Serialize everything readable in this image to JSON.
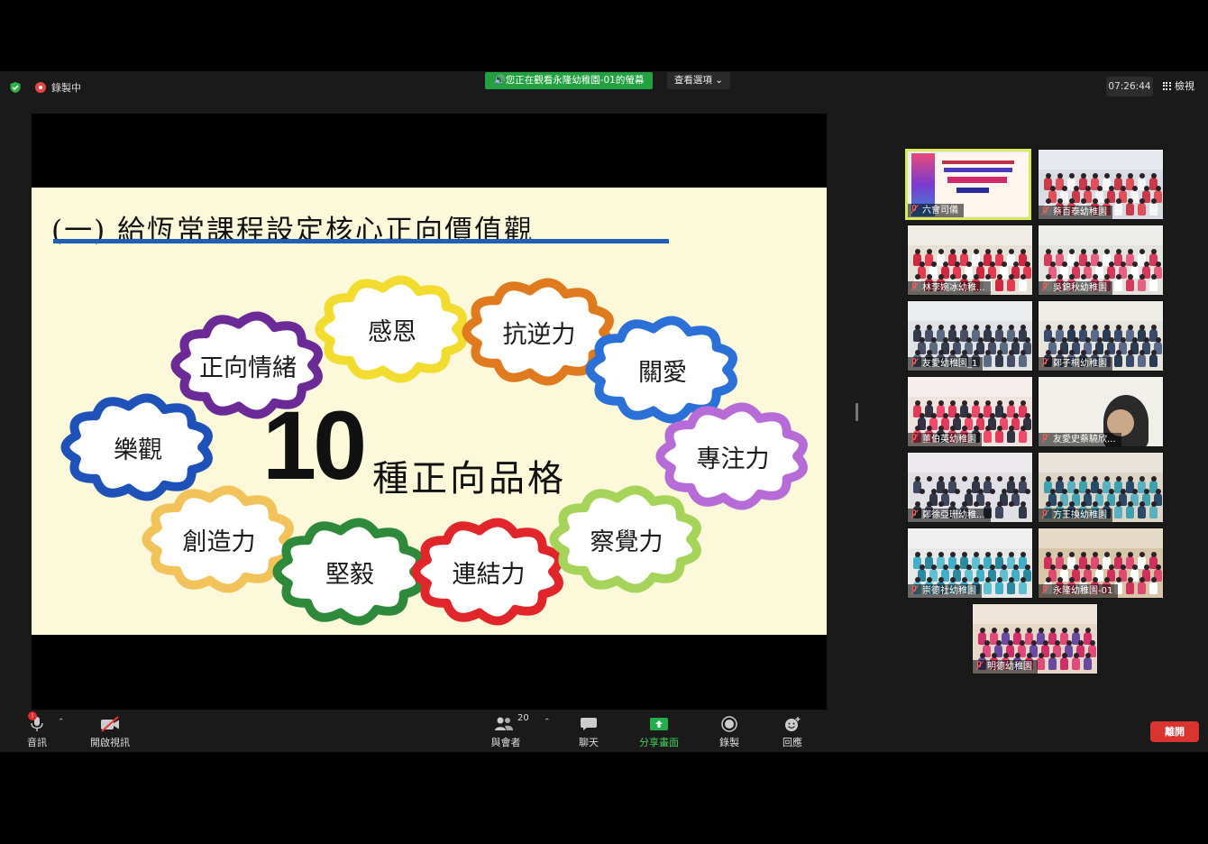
{
  "topbar": {
    "recording_label": "錄製中",
    "viewing_banner": "您正在觀看永隆幼稚園-01的螢幕",
    "view_options": "查看選項",
    "timer": "07:26:44",
    "gallery_view": "檢視"
  },
  "slide": {
    "title": "(一) 給恆常課程設定核心正向價值觀",
    "big_number": "10",
    "big_text": "種正向品格",
    "traits": [
      "正向情緒",
      "感恩",
      "抗逆力",
      "關愛",
      "樂觀",
      "專注力",
      "創造力",
      "堅毅",
      "連結力",
      "察覺力"
    ],
    "trait_colors": [
      "#6b2a96",
      "#f2dc2f",
      "#e07a1f",
      "#2a70d6",
      "#1f52b8",
      "#b66bd6",
      "#f1c35a",
      "#2e8a3a",
      "#e0262a",
      "#a6d35a"
    ]
  },
  "participants": [
    {
      "name": "六會司儀",
      "muted": true
    },
    {
      "name": "蔡百泰幼稚園",
      "muted": true
    },
    {
      "name": "林李婉冰幼稚...",
      "muted": true
    },
    {
      "name": "吳錦秋幼稚園",
      "muted": true
    },
    {
      "name": "友愛幼稚園_1",
      "muted": true
    },
    {
      "name": "鄭子桐幼稚園",
      "muted": true
    },
    {
      "name": "董伯英幼稚園",
      "muted": true
    },
    {
      "name": "友愛史蔡驍欣...",
      "muted": true
    },
    {
      "name": "鄭徐亞珊幼稚...",
      "muted": true
    },
    {
      "name": "方王換幼稚園",
      "muted": true
    },
    {
      "name": "崇德社幼稚園",
      "muted": true
    },
    {
      "name": "永隆幼稚園-01",
      "muted": true
    },
    {
      "name": "明德幼稚園",
      "muted": true
    }
  ],
  "toolbar": {
    "audio": "音訊",
    "audio_badge": "!",
    "video": "開啟視訊",
    "participants": "與會者",
    "participants_count": "20",
    "chat": "聊天",
    "share": "分享畫面",
    "record": "錄製",
    "reactions": "回應",
    "leave": "離開"
  },
  "colors": {
    "accent_green": "#23a03f",
    "leave_red": "#d9342f",
    "active_speaker": "#d9e95b"
  }
}
